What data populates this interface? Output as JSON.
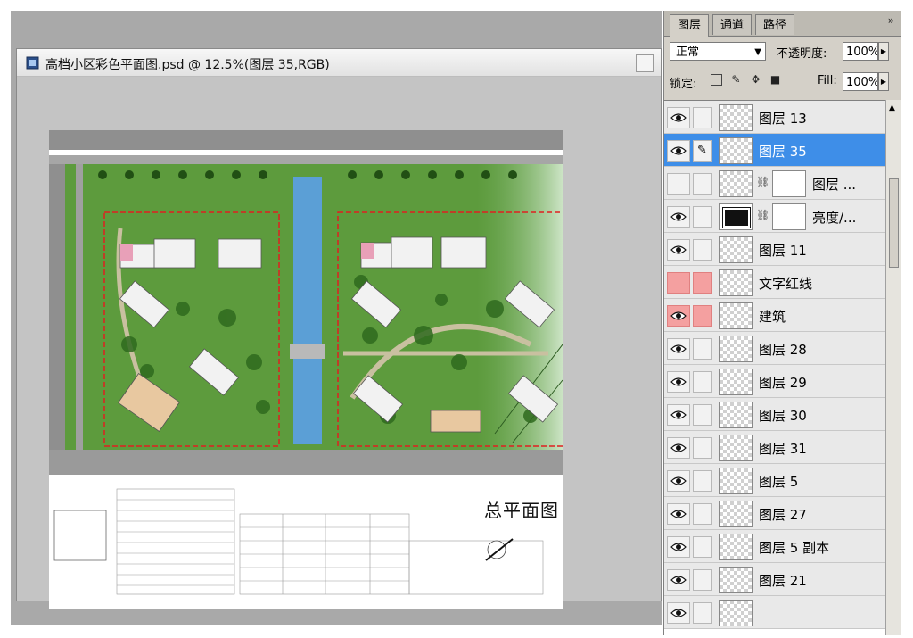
{
  "document": {
    "title": "高档小区彩色平面图.psd @ 12.5%(图层 35,RGB)",
    "icon": "photoshop-file-icon"
  },
  "plan": {
    "title": "总平面图",
    "colors": {
      "grass": "#5d9b3d",
      "tree": "#2f6a1e",
      "water": "#5b9fd6",
      "road": "#9a9a9a",
      "boundary": "#e02020",
      "building": "#f2f2f2"
    }
  },
  "panel": {
    "tabs": [
      "图层",
      "通道",
      "路径"
    ],
    "menu_icon": "»",
    "blend_mode": "正常",
    "opacity_label": "不透明度:",
    "opacity_value": "100%",
    "lock_label": "锁定:",
    "fill_label": "Fill:",
    "fill_value": "100%",
    "lock_icons": [
      "lock-transparency-icon",
      "lock-paint-icon",
      "lock-move-icon",
      "lock-all-icon"
    ]
  },
  "layers": [
    {
      "name": "图层 13",
      "visible": true,
      "selected": false,
      "marked_red": false,
      "has_mask": false
    },
    {
      "name": "图层 35",
      "visible": true,
      "selected": true,
      "marked_red": false,
      "has_mask": false,
      "brush": true
    },
    {
      "name": "图层 ...",
      "visible": false,
      "selected": false,
      "marked_red": false,
      "has_mask": true
    },
    {
      "name": "亮度/...",
      "visible": true,
      "selected": false,
      "marked_red": false,
      "has_mask": true,
      "adjustment": true
    },
    {
      "name": "图层 11",
      "visible": true,
      "selected": false,
      "marked_red": false,
      "has_mask": false
    },
    {
      "name": "文字红线",
      "visible": false,
      "selected": false,
      "marked_red": true,
      "has_mask": false
    },
    {
      "name": "建筑",
      "visible": true,
      "selected": false,
      "marked_red": true,
      "has_mask": false
    },
    {
      "name": "图层 28",
      "visible": true,
      "selected": false,
      "marked_red": false,
      "has_mask": false
    },
    {
      "name": "图层 29",
      "visible": true,
      "selected": false,
      "marked_red": false,
      "has_mask": false
    },
    {
      "name": "图层 30",
      "visible": true,
      "selected": false,
      "marked_red": false,
      "has_mask": false
    },
    {
      "name": "图层 31",
      "visible": true,
      "selected": false,
      "marked_red": false,
      "has_mask": false
    },
    {
      "name": "图层 5",
      "visible": true,
      "selected": false,
      "marked_red": false,
      "has_mask": false
    },
    {
      "name": "图层 27",
      "visible": true,
      "selected": false,
      "marked_red": false,
      "has_mask": false
    },
    {
      "name": "图层 5 副本",
      "visible": true,
      "selected": false,
      "marked_red": false,
      "has_mask": false
    },
    {
      "name": "图层 21",
      "visible": true,
      "selected": false,
      "marked_red": false,
      "has_mask": false
    },
    {
      "name": "",
      "visible": true,
      "selected": false,
      "marked_red": false,
      "has_mask": false
    }
  ]
}
